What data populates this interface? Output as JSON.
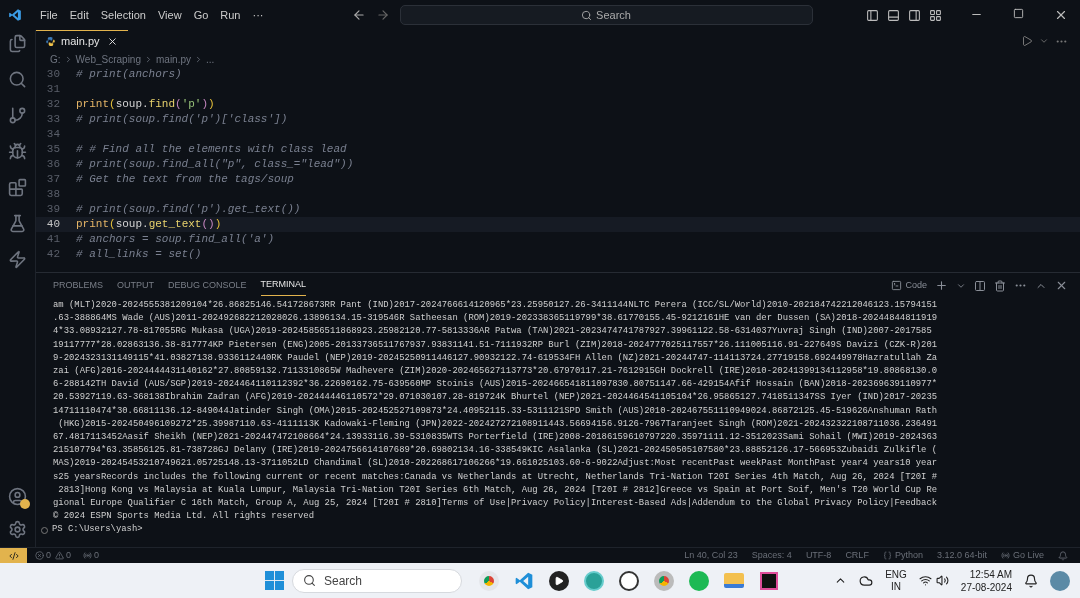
{
  "menu": [
    "File",
    "Edit",
    "Selection",
    "View",
    "Go",
    "Run",
    "···"
  ],
  "command_center": {
    "placeholder": "Search"
  },
  "tabs": [
    {
      "label": "main.py",
      "selected": true
    }
  ],
  "breadcrumb": [
    "G:",
    "Web_Scraping",
    "main.py",
    "..."
  ],
  "editor_lines": [
    {
      "number": "30",
      "kind": "comment",
      "text": "# print(anchors)",
      "selected": false
    },
    {
      "number": "31",
      "kind": "blank",
      "selected": false
    },
    {
      "number": "32",
      "kind": "code",
      "tokens": [
        {
          "kind": "func",
          "text": "print"
        },
        {
          "kind": "paren",
          "text": "("
        },
        {
          "kind": "var",
          "text": "soup"
        },
        {
          "kind": "punct",
          "text": "."
        },
        {
          "kind": "method",
          "text": "find"
        },
        {
          "kind": "paren2",
          "text": "("
        },
        {
          "kind": "string",
          "text": "'p'"
        },
        {
          "kind": "paren2",
          "text": ")"
        },
        {
          "kind": "paren",
          "text": ")"
        }
      ],
      "selected": false
    },
    {
      "number": "33",
      "kind": "comment",
      "text": "# print(soup.find('p')['class'])",
      "selected": false
    },
    {
      "number": "34",
      "kind": "blank",
      "selected": false
    },
    {
      "number": "35",
      "kind": "comment",
      "text": "# # Find all the elements with class lead",
      "selected": false
    },
    {
      "number": "36",
      "kind": "comment",
      "text": "# print(soup.find_all(\"p\", class_=\"lead\"))",
      "selected": false
    },
    {
      "number": "37",
      "kind": "comment",
      "text": "# Get the text from the tags/soup",
      "selected": false
    },
    {
      "number": "38",
      "kind": "blank",
      "selected": false
    },
    {
      "number": "39",
      "kind": "comment",
      "text": "# print(soup.find('p').get_text())",
      "selected": false
    },
    {
      "number": "40",
      "kind": "code",
      "tokens": [
        {
          "kind": "func",
          "text": "print"
        },
        {
          "kind": "paren",
          "text": "("
        },
        {
          "kind": "var",
          "text": "soup"
        },
        {
          "kind": "punct",
          "text": "."
        },
        {
          "kind": "method",
          "text": "get_text"
        },
        {
          "kind": "paren2",
          "text": "()"
        },
        {
          "kind": "paren",
          "text": ")"
        }
      ],
      "selected": true
    },
    {
      "number": "41",
      "kind": "comment",
      "text": "# anchors = soup.find_all('a')",
      "selected": false
    },
    {
      "number": "42",
      "kind": "comment",
      "text": "# all_links = set()",
      "selected": false
    }
  ],
  "panel_tabs": [
    {
      "label": "PROBLEMS",
      "selected": false
    },
    {
      "label": "OUTPUT",
      "selected": false
    },
    {
      "label": "DEBUG CONSOLE",
      "selected": false
    },
    {
      "label": "TERMINAL",
      "selected": true
    }
  ],
  "terminal_profile": "Code",
  "terminal_lines": [
    "am (MLT)2020-2024555381209104*26.86825146.541728673RR Pant (IND)2017-2024766614120965*23.25950127.26-3411144NLTC Perera (ICC/SL/World)2010-202184742212046123.15794151",
    ".63-388864MS Wade (AUS)2011-202492682212028026.13896134.15-319546R Satheesan (ROM)2019-202338365119799*38.61770155.45-9212161HE van der Dussen (SA)2018-20244844811919",
    "4*33.08932127.78-817055RG Mukasa (UGA)2019-20245856511868923.25982120.77-5813336AR Patwa (TAN)2021-2023474741787927.39961122.58-6314037Yuvraj Singh (IND)2007-2017585",
    "19117777*28.02863136.38-817774KP Pietersen (ENG)2005-20133736511767937.93831141.51-7111932RP Burl (ZIM)2018-2024777025117557*26.111005116.91-227649S Davizi (CZK-R)201",
    "9-2024323131149115*41.03827138.9336112440RK Paudel (NEP)2019-20245250911446127.90932122.74-619534FH Allen (NZ)2021-20244747-114113724.27719158.692449978Hazratullah Za",
    "zai (AFG)2016-2024444431140162*27.80859132.7113310865W Madhevere (ZIM)2020-202465627113773*20.67970117.21-7612915GH Dockrell (IRE)2010-20241399134112958*19.80868130.0",
    "6-288142TH David (AUS/SGP)2019-2024464110112392*36.22690162.75-639560MP Stoinis (AUS)2015-202466541811097830.80751147.66-429154Afif Hossain (BAN)2018-202369639110977*",
    "20.53927119.63-368138Ibrahim Zadran (AFG)2019-202444446110572*29.071030107.28-819724K Bhurtel (NEP)2021-2024464541105104*26.95865127.7418511347SS Iyer (IND)2017-20235",
    "14711110474*30.66811136.12-849044Jatinder Singh (OMA)2015-202452527109873*24.40952115.33-5311121SPD Smith (AUS)2010-202467551110949024.86872125.45-519626Anshuman Rath",
    " (HKG)2015-202450496109272*25.39987110.63-4111113K Kadowaki-Fleming (JPN)2022-202427272108911443.56694156.9126-7967Taranjeet Singh (ROM)2021-202432322108711036.236491",
    "67.4817113452Aasif Sheikh (NEP)2021-202447472108664*24.13933116.39-5310835WTS Porterfield (IRE)2008-20186159610797220.35971111.12-3512023Sami Sohail (MWI)2019-2024363",
    "215107794*63.35856125.81-738728GJ Delany (IRE)2019-2024756614107689*20.69802134.16-338549KIC Asalanka (SL)2021-202450505107580*23.88852126.17-566953Zubaidi Zulkifle (",
    "MAS)2019-20245453210749621.05725148.13-3711052LD Chandimal (SL)2010-202268617106266*19.661025103.60-6-9022Adjust:Most recentPast weekPast MonthPast year4 years10 year",
    "s25 yearsRecords includes the following current or recent matches:Canada vs Netherlands at Utrecht, Netherlands Tri-Nation T20I Series 4th Match, Aug 26, 2024 [T20I #",
    " 2813]Hong Kong vs Malaysia at Kuala Lumpur, Malaysia Tri-Nation T20I Series 6th Match, Aug 26, 2024 [T20I # 2812]Greece vs Spain at Port Soif, Men's T20 World Cup Re",
    "gional Europe Qualifier C 16th Match, Group A, Aug 25, 2024 [T20I # 2810]Terms of Use|Privacy Policy|Interest-Based Ads|Addendum to the Global Privacy Policy|Feedback",
    "© 2024 ESPN Sports Media Ltd. All rights reserved"
  ],
  "prompt": "PS C:\\Users\\yash>",
  "status_bar": {
    "errors": "0",
    "warnings": "0",
    "ports": "0",
    "items": [
      "Ln 40, Col 23",
      "Spaces: 4",
      "UTF-8",
      "CRLF"
    ],
    "language": "Python",
    "interpreter": "3.12.0 64-bit",
    "live": "Go Live"
  },
  "taskbar": {
    "search": {
      "placeholder": "Search"
    },
    "language": "ENG",
    "region": "IN",
    "time": "12:54 AM",
    "date": "27-08-2024"
  }
}
